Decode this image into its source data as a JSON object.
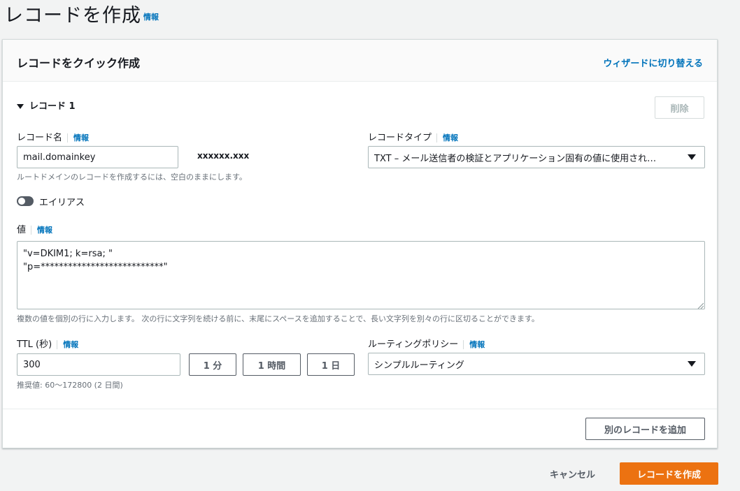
{
  "page": {
    "title": "レコードを作成",
    "info": "情報"
  },
  "panel": {
    "title": "レコードをクイック作成",
    "wizard_link": "ウィザードに切り替える",
    "record_section": "レコード 1",
    "delete_label": "削除",
    "record_name": {
      "label": "レコード名",
      "info": "情報",
      "value": "mail.domainkey",
      "domain_suffix": "xxxxxx.xxx",
      "hint": "ルートドメインのレコードを作成するには、空白のままにします。"
    },
    "record_type": {
      "label": "レコードタイプ",
      "info": "情報",
      "value": "TXT – メール送信者の検証とアプリケーション固有の値に使用され…"
    },
    "alias": {
      "label": "エイリアス",
      "enabled": false
    },
    "value": {
      "label": "値",
      "info": "情報",
      "text": "\"v=DKIM1; k=rsa; \"\n\"p=***************************\"",
      "hint": "複数の値を個別の行に入力します。 次の行に文字列を続ける前に、末尾にスペースを追加することで、長い文字列を別々の行に区切ることができます。"
    },
    "ttl": {
      "label": "TTL (秒)",
      "info": "情報",
      "value": "300",
      "preset_1m": "1 分",
      "preset_1h": "1 時間",
      "preset_1d": "1 日",
      "hint": "推奨値: 60〜172800 (2 日間)"
    },
    "routing": {
      "label": "ルーティングポリシー",
      "info": "情報",
      "value": "シンプルルーティング"
    },
    "add_record_label": "別のレコードを追加"
  },
  "footer": {
    "cancel_label": "キャンセル",
    "create_label": "レコードを作成"
  },
  "colors": {
    "accent": "#ec7211",
    "link": "#0073bb",
    "toggle_off": "#545b64"
  }
}
